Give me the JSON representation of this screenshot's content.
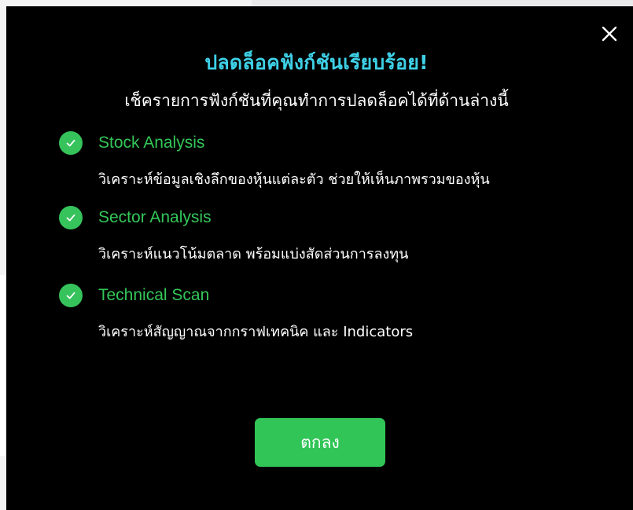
{
  "modal": {
    "title": "ปลดล็อคฟังก์ชันเรียบร้อย!",
    "subtitle": "เช็ครายการฟังก์ชันที่คุณทำการปลดล็อคได้ที่ด้านล่างนี้",
    "close_icon": "close-icon",
    "features": [
      {
        "name": "Stock Analysis",
        "description": "วิเคราะห์ข้อมูลเชิงลึกของหุ้นแต่ละตัว ช่วยให้เห็นภาพรวมของหุ้น",
        "icon": "check-circle-icon"
      },
      {
        "name": "Sector Analysis",
        "description": "วิเคราะห์แนวโน้มตลาด พร้อมแบ่งสัดส่วนการลงทุน",
        "icon": "check-circle-icon"
      },
      {
        "name": "Technical Scan",
        "description": "วิเคราะห์สัญญาณจากกราฟเทคนิค และ Indicators",
        "icon": "check-circle-icon"
      }
    ],
    "ok_label": "ตกลง"
  },
  "colors": {
    "title": "#3ed0e6",
    "accent_green": "#34c759",
    "button_green": "#31c557",
    "modal_bg": "#000000"
  }
}
